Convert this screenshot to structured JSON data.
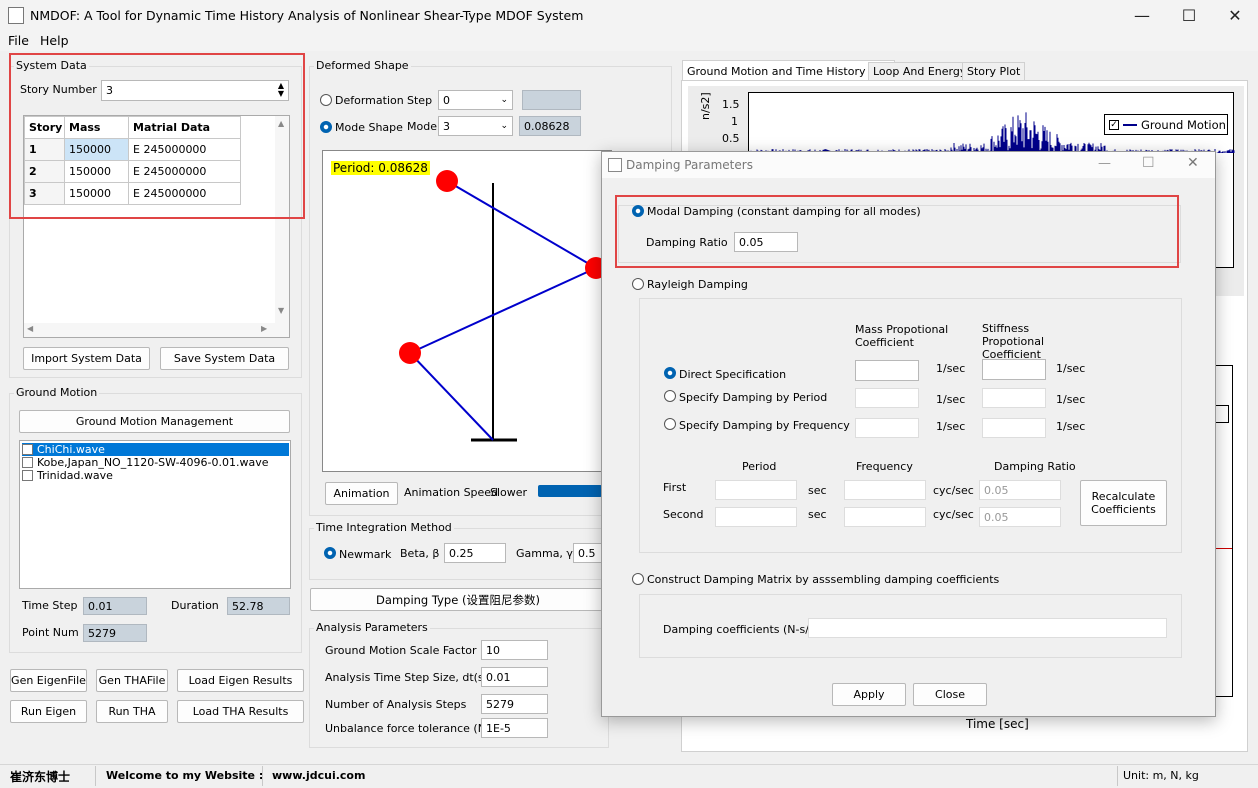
{
  "window": {
    "title": "NMDOF: A Tool for Dynamic Time History Analysis of Nonlinear Shear-Type MDOF System"
  },
  "menu": [
    "File",
    "Help"
  ],
  "system_data": {
    "label": "System Data",
    "story_number_label": "Story Number",
    "story_number": "3",
    "columns": [
      "Story",
      "Mass",
      "Matrial Data"
    ],
    "rows": [
      [
        "1",
        "150000",
        "E 245000000"
      ],
      [
        "2",
        "150000",
        "E 245000000"
      ],
      [
        "3",
        "150000",
        "E 245000000"
      ]
    ],
    "import_button": "Import System Data",
    "save_button": "Save System Data"
  },
  "ground_motion": {
    "label": "Ground Motion",
    "management_button": "Ground Motion Management",
    "files": [
      "ChiChi.wave",
      "Kobe,Japan_NO_1120-SW-4096-0.01.wave",
      "Trinidad.wave"
    ],
    "time_step_label": "Time Step",
    "time_step": "0.01",
    "duration_label": "Duration",
    "duration": "52.78",
    "point_num_label": "Point Num",
    "point_num": "5279"
  },
  "action_buttons": {
    "gen_eigen": "Gen EigenFile",
    "gen_tha": "Gen THAFile",
    "load_eigen": "Load Eigen Results",
    "run_eigen": "Run Eigen",
    "run_tha": "Run THA",
    "load_tha": "Load THA Results"
  },
  "deformed_shape": {
    "label": "Deformed Shape",
    "deformation_label": "Deformation",
    "step_label": "Step",
    "step_value": "0",
    "mode_shape_label": "Mode Shape",
    "mode_label": "Mode",
    "mode_value": "3",
    "period_value": "0.08628",
    "period_banner": "Period: 0.08628",
    "animation_button": "Animation",
    "animation_speed_label": "Animation Speed",
    "slower_label": "Slower"
  },
  "time_integration": {
    "label": "Time Integration Method",
    "newmark_label": "Newmark",
    "beta_label": "Beta, β",
    "beta": "0.25",
    "gamma_label": "Gamma, γ",
    "gamma": "0.5"
  },
  "damping_type_button": "Damping Type (设置阻尼参数)",
  "analysis_parameters": {
    "label": "Analysis Parameters",
    "items": [
      {
        "label": "Ground Motion Scale Factor",
        "value": "10"
      },
      {
        "label": "Analysis Time Step Size, dt(s)",
        "value": "0.01"
      },
      {
        "label": "Number of Analysis Steps",
        "value": "5279"
      },
      {
        "label": "Unbalance force tolerance (N)",
        "value": "1E-5"
      }
    ]
  },
  "tabs": [
    "Ground Motion and Time History Plot",
    "Loop And Energy",
    "Story Plot"
  ],
  "plot": {
    "ylabel_fragment": "n/s2]",
    "yticks": [
      "1.5",
      "1",
      "0.5"
    ],
    "legend": "Ground Motion",
    "xlabel": "Time [sec]"
  },
  "dialog": {
    "title": "Damping Parameters",
    "modal_label": "Modal Damping (constant damping for all modes)",
    "damping_ratio_label": "Damping Ratio",
    "damping_ratio": "0.05",
    "rayleigh_label": "Rayleigh Damping",
    "mass_coef_header": "Mass Propotional Coefficient",
    "stiff_coef_header": "Stiffness Propotional Coefficient",
    "options": [
      "Direct Specification",
      "Specify Damping by Period",
      "Specify Damping by Frequency"
    ],
    "unit_persec": "1/sec",
    "period_header": "Period",
    "frequency_header": "Frequency",
    "ratio_header": "Damping Ratio",
    "first_label": "First",
    "second_label": "Second",
    "sec_unit": "sec",
    "cyc_unit": "cyc/sec",
    "first_ratio": "0.05",
    "second_ratio": "0.05",
    "recalc_button": "Recalculate Coefficients",
    "construct_label": "Construct Damping Matrix by asssembling damping coefficients",
    "coefficients_label": "Damping coefficients (N-s/m)",
    "apply_button": "Apply",
    "close_button": "Close"
  },
  "status": {
    "author": "崔济东博士",
    "welcome": "Welcome to my Website :",
    "website": "www.jdcui.com",
    "units": "Unit: m, N, kg"
  },
  "colors": {
    "accent": "#0063b1",
    "highlight": "#e04545",
    "plot_series": "#00008b",
    "period_bg": "#ffff00"
  }
}
